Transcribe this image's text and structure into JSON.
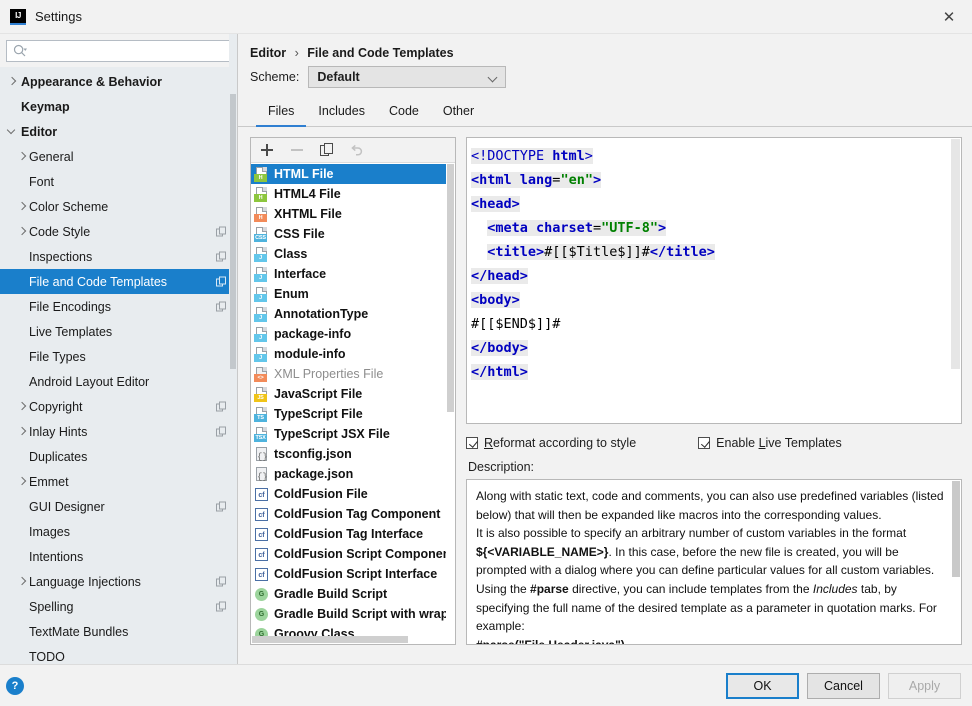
{
  "window": {
    "title": "Settings",
    "app_icon": "intellij-idea-icon",
    "close_icon": "close-icon"
  },
  "search": {
    "value": "",
    "placeholder": "",
    "icon": "search-icon"
  },
  "sidebar": {
    "items": [
      {
        "label": "Appearance & Behavior",
        "level": 0,
        "arrow": "collapsed",
        "copy": false
      },
      {
        "label": "Keymap",
        "level": 0,
        "arrow": "none",
        "copy": false
      },
      {
        "label": "Editor",
        "level": 0,
        "arrow": "expanded",
        "copy": false
      },
      {
        "label": "General",
        "level": 1,
        "arrow": "collapsed",
        "copy": false
      },
      {
        "label": "Font",
        "level": 1,
        "arrow": "none",
        "copy": false
      },
      {
        "label": "Color Scheme",
        "level": 1,
        "arrow": "collapsed",
        "copy": false
      },
      {
        "label": "Code Style",
        "level": 1,
        "arrow": "collapsed",
        "copy": true
      },
      {
        "label": "Inspections",
        "level": 1,
        "arrow": "none",
        "copy": true
      },
      {
        "label": "File and Code Templates",
        "level": 1,
        "arrow": "none",
        "copy": true,
        "selected": true
      },
      {
        "label": "File Encodings",
        "level": 1,
        "arrow": "none",
        "copy": true
      },
      {
        "label": "Live Templates",
        "level": 1,
        "arrow": "none",
        "copy": false
      },
      {
        "label": "File Types",
        "level": 1,
        "arrow": "none",
        "copy": false
      },
      {
        "label": "Android Layout Editor",
        "level": 1,
        "arrow": "none",
        "copy": false
      },
      {
        "label": "Copyright",
        "level": 1,
        "arrow": "collapsed",
        "copy": true
      },
      {
        "label": "Inlay Hints",
        "level": 1,
        "arrow": "collapsed",
        "copy": true
      },
      {
        "label": "Duplicates",
        "level": 1,
        "arrow": "none",
        "copy": false
      },
      {
        "label": "Emmet",
        "level": 1,
        "arrow": "collapsed",
        "copy": false
      },
      {
        "label": "GUI Designer",
        "level": 1,
        "arrow": "none",
        "copy": true
      },
      {
        "label": "Images",
        "level": 1,
        "arrow": "none",
        "copy": false
      },
      {
        "label": "Intentions",
        "level": 1,
        "arrow": "none",
        "copy": false
      },
      {
        "label": "Language Injections",
        "level": 1,
        "arrow": "collapsed",
        "copy": true
      },
      {
        "label": "Spelling",
        "level": 1,
        "arrow": "none",
        "copy": true
      },
      {
        "label": "TextMate Bundles",
        "level": 1,
        "arrow": "none",
        "copy": false
      },
      {
        "label": "TODO",
        "level": 1,
        "arrow": "none",
        "copy": false
      }
    ]
  },
  "breadcrumb": {
    "parent": "Editor",
    "separator": "›",
    "current": "File and Code Templates"
  },
  "scheme": {
    "label": "Scheme:",
    "value": "Default",
    "chevron_icon": "chevron-down-icon"
  },
  "tabs": [
    {
      "label": "Files",
      "active": true
    },
    {
      "label": "Includes",
      "active": false
    },
    {
      "label": "Code",
      "active": false
    },
    {
      "label": "Other",
      "active": false
    }
  ],
  "list_toolbar": {
    "add": "add-icon",
    "remove": "remove-icon",
    "copy": "copy-icon",
    "revert": "revert-icon"
  },
  "templates": [
    {
      "label": "HTML File",
      "icon": "html-file-icon",
      "badge": "H",
      "badge_color": "#8dc63f",
      "selected": true
    },
    {
      "label": "HTML4 File",
      "icon": "html4-file-icon",
      "badge": "H",
      "badge_color": "#8dc63f"
    },
    {
      "label": "XHTML File",
      "icon": "xhtml-file-icon",
      "badge": "H",
      "badge_color": "#f28b5a"
    },
    {
      "label": "CSS File",
      "icon": "css-file-icon",
      "badge": "CSS",
      "badge_color": "#4fb3dd"
    },
    {
      "label": "Class",
      "icon": "java-class-icon",
      "badge": "J",
      "badge_color": "#63c6ea"
    },
    {
      "label": "Interface",
      "icon": "java-interface-icon",
      "badge": "J",
      "badge_color": "#63c6ea"
    },
    {
      "label": "Enum",
      "icon": "java-enum-icon",
      "badge": "J",
      "badge_color": "#63c6ea"
    },
    {
      "label": "AnnotationType",
      "icon": "java-annotation-icon",
      "badge": "J",
      "badge_color": "#63c6ea"
    },
    {
      "label": "package-info",
      "icon": "java-package-info-icon",
      "badge": "J",
      "badge_color": "#63c6ea"
    },
    {
      "label": "module-info",
      "icon": "java-module-info-icon",
      "badge": "J",
      "badge_color": "#63c6ea"
    },
    {
      "label": "XML Properties File",
      "icon": "xml-properties-file-icon",
      "badge": "<>",
      "badge_color": "#f28b5a",
      "dim": true
    },
    {
      "label": "JavaScript File",
      "icon": "javascript-file-icon",
      "badge": "JS",
      "badge_color": "#f0c419"
    },
    {
      "label": "TypeScript File",
      "icon": "typescript-file-icon",
      "badge": "TS",
      "badge_color": "#4fb3dd"
    },
    {
      "label": "TypeScript JSX File",
      "icon": "typescript-jsx-file-icon",
      "badge": "TSX",
      "badge_color": "#4fb3dd"
    },
    {
      "label": "tsconfig.json",
      "icon": "json-file-icon",
      "badge": "",
      "badge_color": ""
    },
    {
      "label": "package.json",
      "icon": "json-file-icon",
      "badge": "",
      "badge_color": ""
    },
    {
      "label": "ColdFusion File",
      "icon": "coldfusion-file-icon",
      "badge": "cf",
      "badge_color": ""
    },
    {
      "label": "ColdFusion Tag Component",
      "icon": "coldfusion-tag-component-icon",
      "badge": "cf",
      "badge_color": ""
    },
    {
      "label": "ColdFusion Tag Interface",
      "icon": "coldfusion-tag-interface-icon",
      "badge": "cf",
      "badge_color": ""
    },
    {
      "label": "ColdFusion Script Component",
      "icon": "coldfusion-script-component-icon",
      "badge": "cf",
      "badge_color": ""
    },
    {
      "label": "ColdFusion Script Interface",
      "icon": "coldfusion-script-interface-icon",
      "badge": "cf",
      "badge_color": ""
    },
    {
      "label": "Gradle Build Script",
      "icon": "gradle-icon",
      "badge": "G",
      "badge_color": ""
    },
    {
      "label": "Gradle Build Script with wrapper",
      "icon": "gradle-icon",
      "badge": "G",
      "badge_color": ""
    },
    {
      "label": "Groovy Class",
      "icon": "groovy-icon",
      "badge": "G",
      "badge_color": ""
    }
  ],
  "code": {
    "lines": [
      [
        {
          "t": "<!DOCTYPE ",
          "c": "doctype",
          "hl": true
        },
        {
          "t": "html",
          "c": "tagname",
          "hl": true
        },
        {
          "t": ">",
          "c": "doctype",
          "hl": true
        }
      ],
      [
        {
          "t": "<html ",
          "c": "tagname",
          "hl": true
        },
        {
          "t": "lang",
          "c": "attr",
          "hl": true
        },
        {
          "t": "=",
          "c": "tagpunct",
          "hl": true
        },
        {
          "t": "\"en\"",
          "c": "attrval",
          "hl": true
        },
        {
          "t": ">",
          "c": "tagname",
          "hl": true
        }
      ],
      [
        {
          "t": "<head>",
          "c": "tagname",
          "hl": true
        }
      ],
      [
        {
          "t": "  ",
          "c": "plain",
          "hl": false
        },
        {
          "t": "<meta ",
          "c": "tagname",
          "hl": true
        },
        {
          "t": "charset",
          "c": "attr",
          "hl": true
        },
        {
          "t": "=",
          "c": "tagpunct",
          "hl": true
        },
        {
          "t": "\"UTF-8\"",
          "c": "attrval",
          "hl": true
        },
        {
          "t": ">",
          "c": "tagname",
          "hl": true
        }
      ],
      [
        {
          "t": "  ",
          "c": "plain",
          "hl": false
        },
        {
          "t": "<title>",
          "c": "tagname",
          "hl": true
        },
        {
          "t": "#[[$Title$]]#",
          "c": "plain",
          "hl": true
        },
        {
          "t": "</title>",
          "c": "tagname",
          "hl": true
        }
      ],
      [
        {
          "t": "</head>",
          "c": "tagname",
          "hl": true
        }
      ],
      [
        {
          "t": "<body>",
          "c": "tagname",
          "hl": true
        }
      ],
      [
        {
          "t": "#[[$END$]]#",
          "c": "plain",
          "hl": false
        }
      ],
      [
        {
          "t": "</body>",
          "c": "tagname",
          "hl": true
        }
      ],
      [
        {
          "t": "</html>",
          "c": "tagname",
          "hl": true
        }
      ]
    ]
  },
  "options": {
    "reformat": {
      "label_before": "R",
      "label_after": "eformat according to style",
      "checked": true
    },
    "live_templates": {
      "label_before": "L",
      "label_pre": "Enable ",
      "label_after": "ive Templates",
      "checked": true
    }
  },
  "description": {
    "label": "Description:",
    "paragraphs": [
      "Along with static text, code and comments, you can also use predefined variables (listed below) that will then be expanded like macros into the corresponding values.",
      "It is also possible to specify an arbitrary number of custom variables in the format ${<VARIABLE_NAME>}. In this case, before the new file is created, you will be prompted with a dialog where you can define particular values for all custom variables.",
      "Using the #parse directive, you can include templates from the Includes tab, by specifying the full name of the desired template as a parameter in quotation marks. For example:",
      "#parse(\"File Header.java\")"
    ],
    "bold_terms": [
      "${<VARIABLE_NAME>}",
      "#parse",
      "#parse(\"File Header.java\")"
    ],
    "italic_terms": [
      "Includes"
    ]
  },
  "footer": {
    "help_icon": "help-icon",
    "help_label": "?",
    "buttons": [
      {
        "label": "OK",
        "state": "default"
      },
      {
        "label": "Cancel",
        "state": "normal"
      },
      {
        "label": "Apply",
        "state": "disabled"
      }
    ]
  },
  "colors": {
    "accent": "#1a7fcb",
    "sidebar_bg": "#e8ecef",
    "dialog_bg": "#f2f2f2",
    "tag_color": "#0000c0",
    "attr_value_color": "#008000"
  }
}
